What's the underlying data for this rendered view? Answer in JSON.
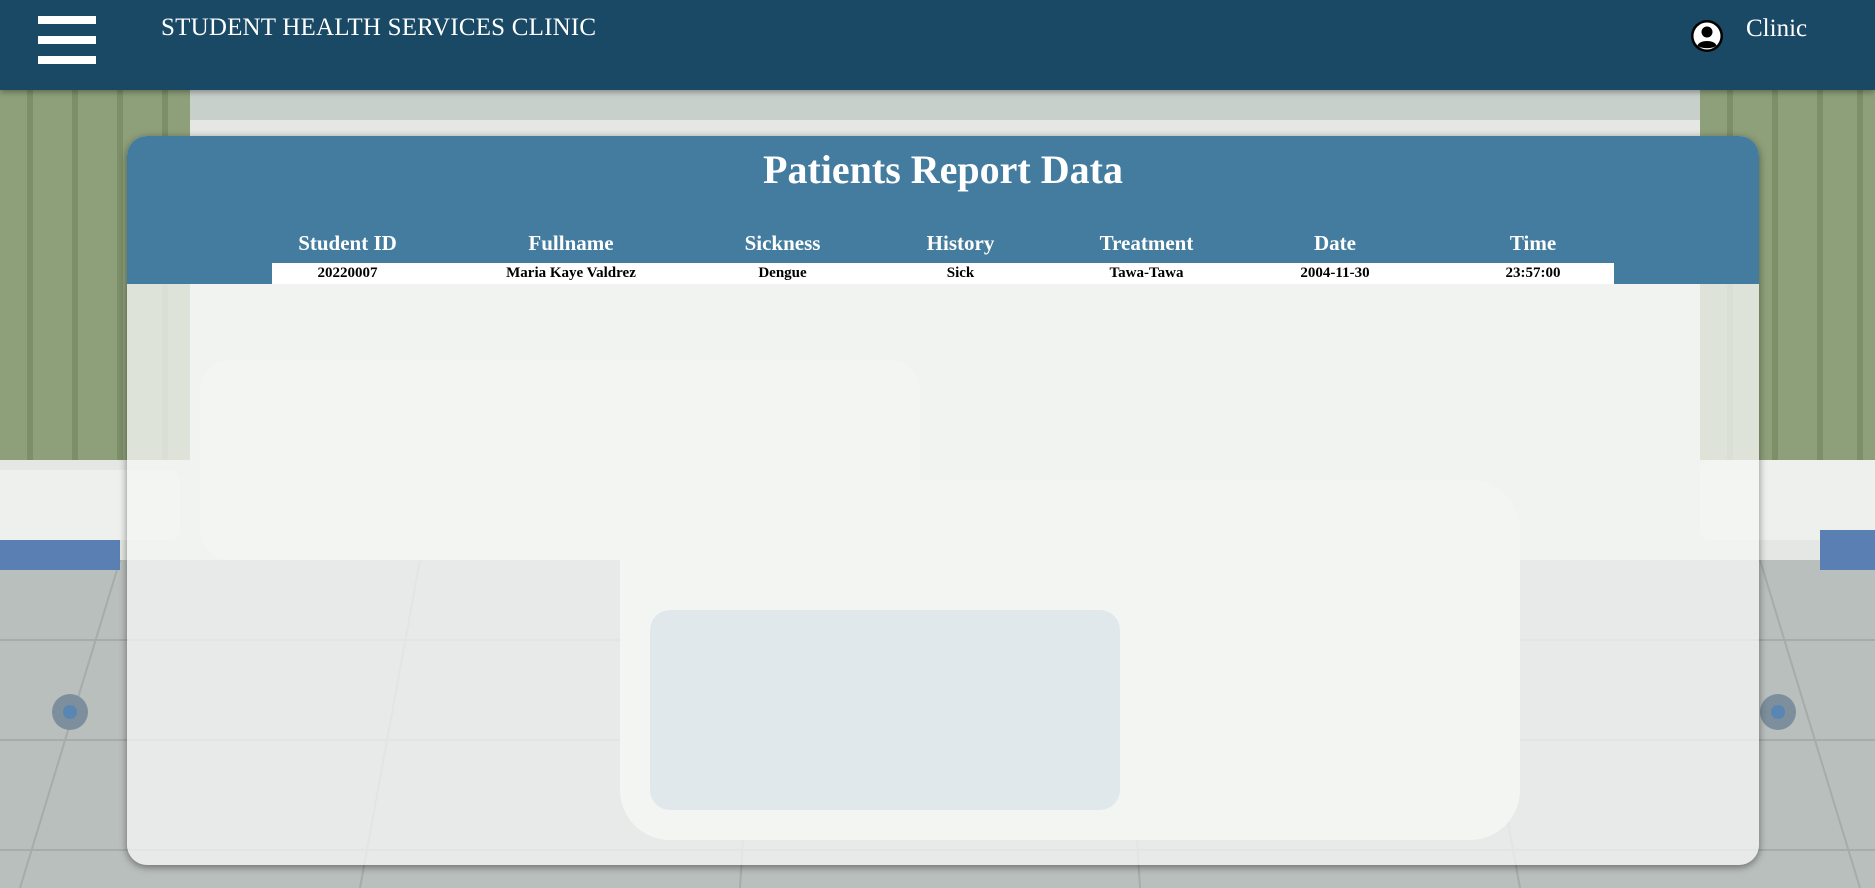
{
  "header": {
    "app_title": "STUDENT HEALTH SERVICES CLINIC",
    "user_label": "Clinic",
    "menu_icon": "hamburger-menu-icon",
    "user_icon": "user-circle-icon",
    "background_color": "#194965"
  },
  "report": {
    "title": "Patients Report Data",
    "header_color": "#437c9e",
    "columns": [
      "Student ID",
      "Fullname",
      "Sickness",
      "History",
      "Treatment",
      "Date",
      "Time"
    ],
    "rows": [
      [
        "20220007",
        "Maria Kaye Valdrez",
        "Dengue",
        "Sick",
        "Tawa-Tawa",
        "2004-11-30",
        "23:57:00"
      ]
    ]
  }
}
